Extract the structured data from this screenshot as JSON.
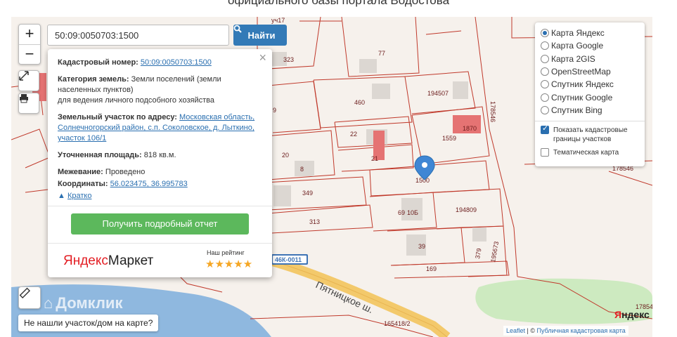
{
  "page": {
    "title": "официального базы портала Водостова"
  },
  "search": {
    "value": "50:09:0050703:1500",
    "button_label": "Найти"
  },
  "zoom": {
    "in_label": "+",
    "out_label": "−"
  },
  "popup": {
    "cadastral_label": "Кадастровый номер:",
    "cadastral_value": "50:09:0050703:1500",
    "category_label": "Категория земель:",
    "category_value": "Земли поселений (земли населенных пунктов)",
    "usage_value": "для ведения личного подсобного хозяйства",
    "address_label": "Земельный участок по адресу:",
    "address_value": "Московская область, Солнечногорский район, с.п. Соколовское, д. Лыткино, участок 106/1",
    "area_label": "Уточненная площадь:",
    "area_value": "818 кв.м.",
    "survey_label": "Межевание:",
    "survey_value": "Проведено",
    "coords_label": "Координаты:",
    "coords_value": "56.023475, 36.995783",
    "collapse_label": "Кратко",
    "report_button": "Получить подробный отчет",
    "market_brand_1": "Яндекс",
    "market_brand_2": "Маркет",
    "rating_label": "Наш рейтинг",
    "stars": "★★★★★"
  },
  "layers": {
    "options": [
      {
        "label": "Карта Яндекс",
        "selected": true
      },
      {
        "label": "Карта Google",
        "selected": false
      },
      {
        "label": "Карта 2GIS",
        "selected": false
      },
      {
        "label": "OpenStreetMap",
        "selected": false
      },
      {
        "label": "Спутник Яндекс",
        "selected": false
      },
      {
        "label": "Спутник Google",
        "selected": false
      },
      {
        "label": "Спутник Bing",
        "selected": false
      }
    ],
    "show_borders_label": "Показать кадастровые границы участков",
    "show_borders_checked": true,
    "thematic_label": "Тематическая карта",
    "thematic_checked": false
  },
  "map": {
    "parcel_labels": [
      "323",
      "77",
      "460",
      "194507",
      "178546",
      "22",
      "1870",
      "1559",
      "20",
      "21",
      "8",
      "1500",
      "349",
      "313",
      "69",
      "10Б",
      "194809",
      "39",
      "169",
      "379",
      "195673",
      "178546",
      "165418/2",
      "17854",
      "уч17",
      "9"
    ],
    "road_label": "Пятницкое ш.",
    "road_badge": "46К-0011",
    "selected_parcel": "1500"
  },
  "watermark": {
    "domclick": "Домклик"
  },
  "not_found_button": "Не нашли участок/дом на карте?",
  "yandex_logo": {
    "part1": "Я",
    "part2": "ндекс"
  },
  "attribution": {
    "leaflet": "Leaflet",
    "separator": " | © ",
    "source": "Публичная кадастровая карта"
  },
  "colors": {
    "primary": "#337ab7",
    "success": "#5cb85c",
    "parcel_border": "#c0392b",
    "water": "#8fb8df",
    "green": "#cdeac0"
  }
}
